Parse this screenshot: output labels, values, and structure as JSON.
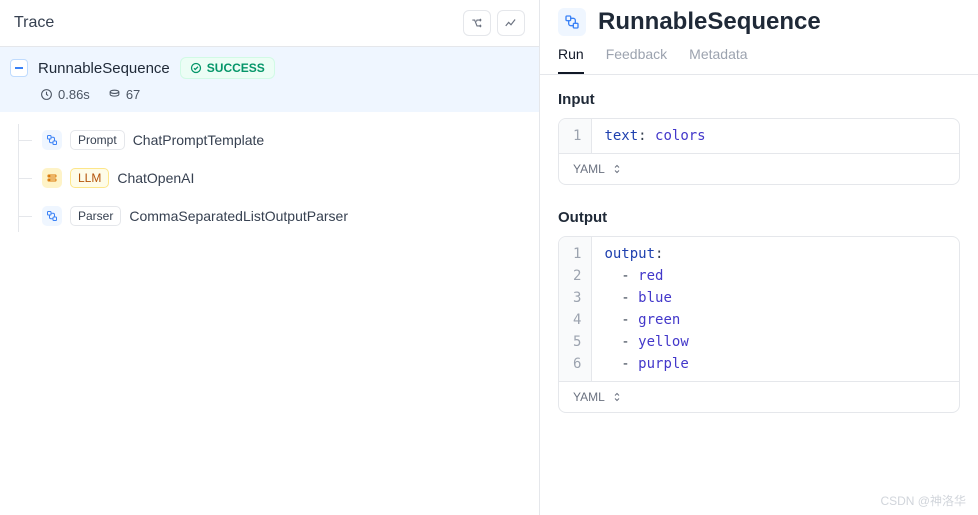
{
  "left": {
    "title": "Trace",
    "root": {
      "name": "RunnableSequence",
      "status": "SUCCESS",
      "duration": "0.86s",
      "tokens": "67"
    },
    "steps": [
      {
        "kind": "Prompt",
        "name": "ChatPromptTemplate",
        "icon": "chain"
      },
      {
        "kind": "LLM",
        "name": "ChatOpenAI",
        "icon": "llm"
      },
      {
        "kind": "Parser",
        "name": "CommaSeparatedListOutputParser",
        "icon": "chain"
      }
    ]
  },
  "right": {
    "title": "RunnableSequence",
    "tabs": [
      "Run",
      "Feedback",
      "Metadata"
    ],
    "active_tab": 0,
    "input_label": "Input",
    "output_label": "Output",
    "format_label": "YAML",
    "input_lines": [
      {
        "n": "1",
        "html": "<span class='tok-key'>text</span><span class='tok-punc'>:</span> <span class='tok-str'>colors</span>"
      }
    ],
    "output_lines": [
      {
        "n": "1",
        "html": "<span class='tok-key'>output</span><span class='tok-punc'>:</span>"
      },
      {
        "n": "2",
        "html": "  <span class='tok-punc'>-</span> <span class='tok-str'>red</span>"
      },
      {
        "n": "3",
        "html": "  <span class='tok-punc'>-</span> <span class='tok-str'>blue</span>"
      },
      {
        "n": "4",
        "html": "  <span class='tok-punc'>-</span> <span class='tok-str'>green</span>"
      },
      {
        "n": "5",
        "html": "  <span class='tok-punc'>-</span> <span class='tok-str'>yellow</span>"
      },
      {
        "n": "6",
        "html": "  <span class='tok-punc'>-</span> <span class='tok-str'>purple</span>"
      }
    ]
  },
  "watermark": "CSDN @神洛华"
}
